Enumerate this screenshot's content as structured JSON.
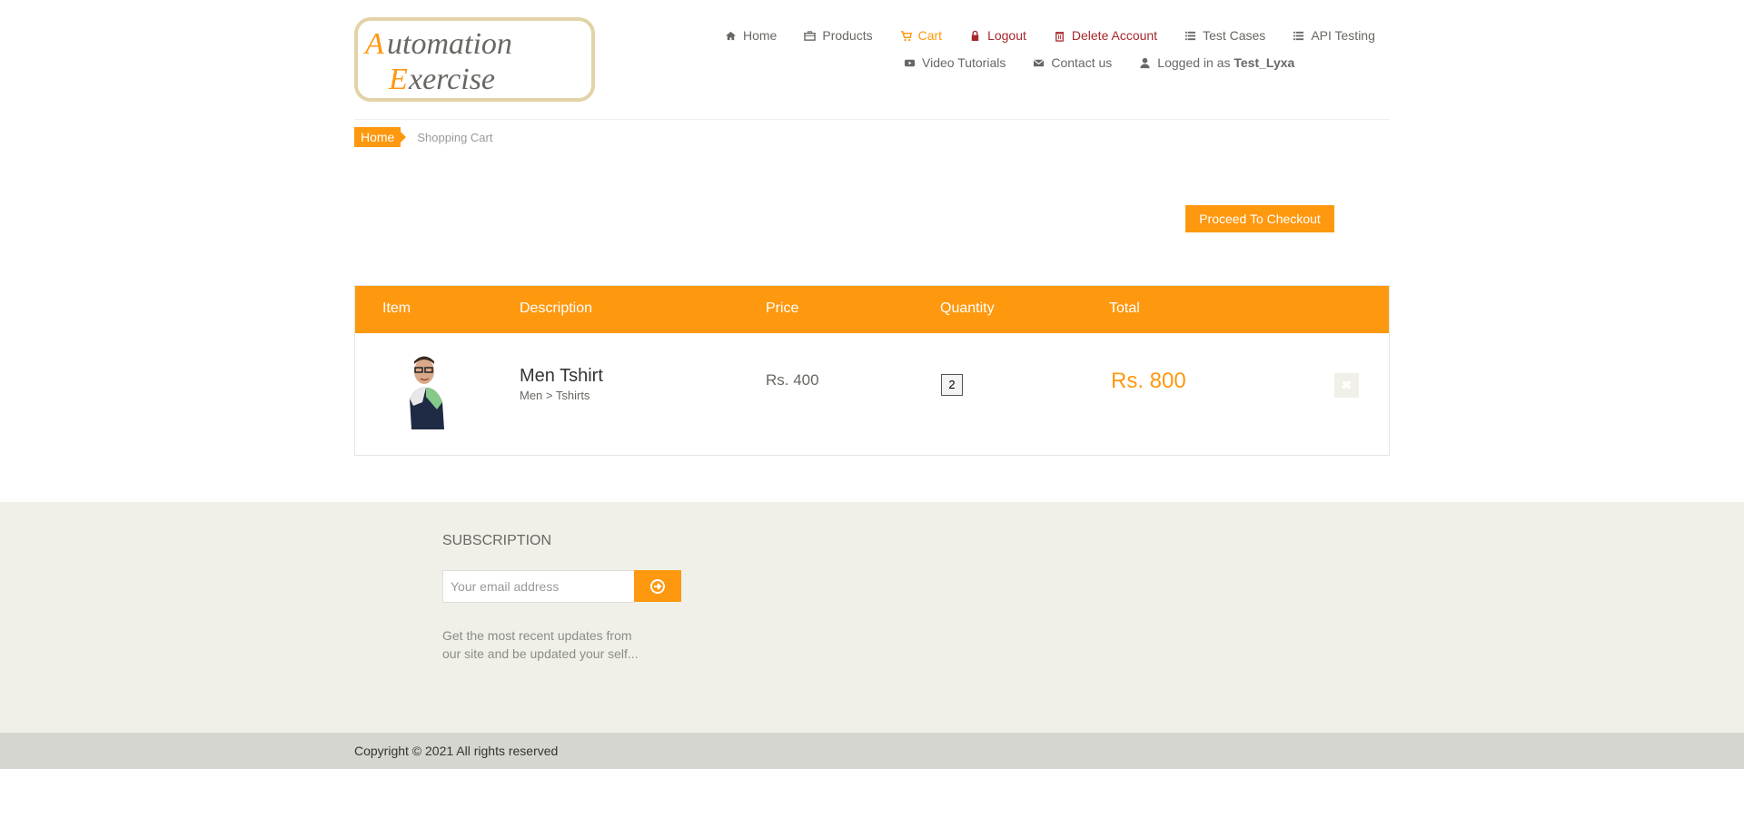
{
  "header": {
    "logo_text_line1": "Automation",
    "logo_text_line2": "Exercise",
    "nav": [
      {
        "label": "Home",
        "icon": "home-icon"
      },
      {
        "label": "Products",
        "icon": "briefcase-icon"
      },
      {
        "label": "Cart",
        "icon": "cart-icon"
      },
      {
        "label": "Logout",
        "icon": "lock-icon"
      },
      {
        "label": "Delete Account",
        "icon": "trash-icon"
      },
      {
        "label": "Test Cases",
        "icon": "list-icon"
      },
      {
        "label": "API Testing",
        "icon": "list-icon"
      },
      {
        "label": "Video Tutorials",
        "icon": "youtube-play-icon"
      },
      {
        "label": "Contact us",
        "icon": "envelope-icon"
      }
    ],
    "logged_in_prefix": "Logged in as",
    "username": "Test_Lyxa"
  },
  "breadcrumb": {
    "home": "Home",
    "current": "Shopping Cart"
  },
  "checkout_label": "Proceed To Checkout",
  "cart": {
    "columns": [
      "Item",
      "Description",
      "Price",
      "Quantity",
      "Total"
    ],
    "items": [
      {
        "name": "Men Tshirt",
        "category": "Men > Tshirts",
        "price": "Rs. 400",
        "quantity": "2",
        "total": "Rs. 800"
      }
    ]
  },
  "footer": {
    "subscription_title": "SUBSCRIPTION",
    "email_placeholder": "Your email address",
    "subscription_text": "Get the most recent updates from our site and be updated your self...",
    "copyright": "Copyright © 2021 All rights reserved"
  },
  "colors": {
    "accent": "#FE980F",
    "danger": "#A8272C",
    "footer_bg": "#F0F0E9"
  }
}
